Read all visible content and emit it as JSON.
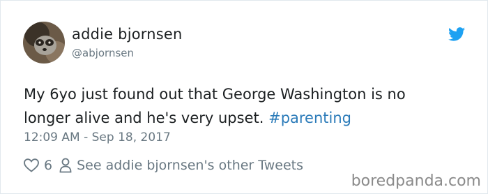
{
  "author": {
    "display_name": "addie bjornsen",
    "handle": "@abjornsen",
    "avatar_icon": "raccoon-avatar"
  },
  "tweet": {
    "text_line1": "My 6yo just found out that George Washington is no",
    "text_line2_prefix": "longer alive and he's very upset. ",
    "hashtag": "#parenting",
    "timestamp": "12:09 AM - Sep 18, 2017"
  },
  "actions": {
    "like_count": "6",
    "other_tweets_label": "See addie bjornsen's other Tweets"
  },
  "brand": {
    "icon": "twitter-bird-icon",
    "color": "#1da1f2"
  },
  "watermark": "boredpanda.com"
}
